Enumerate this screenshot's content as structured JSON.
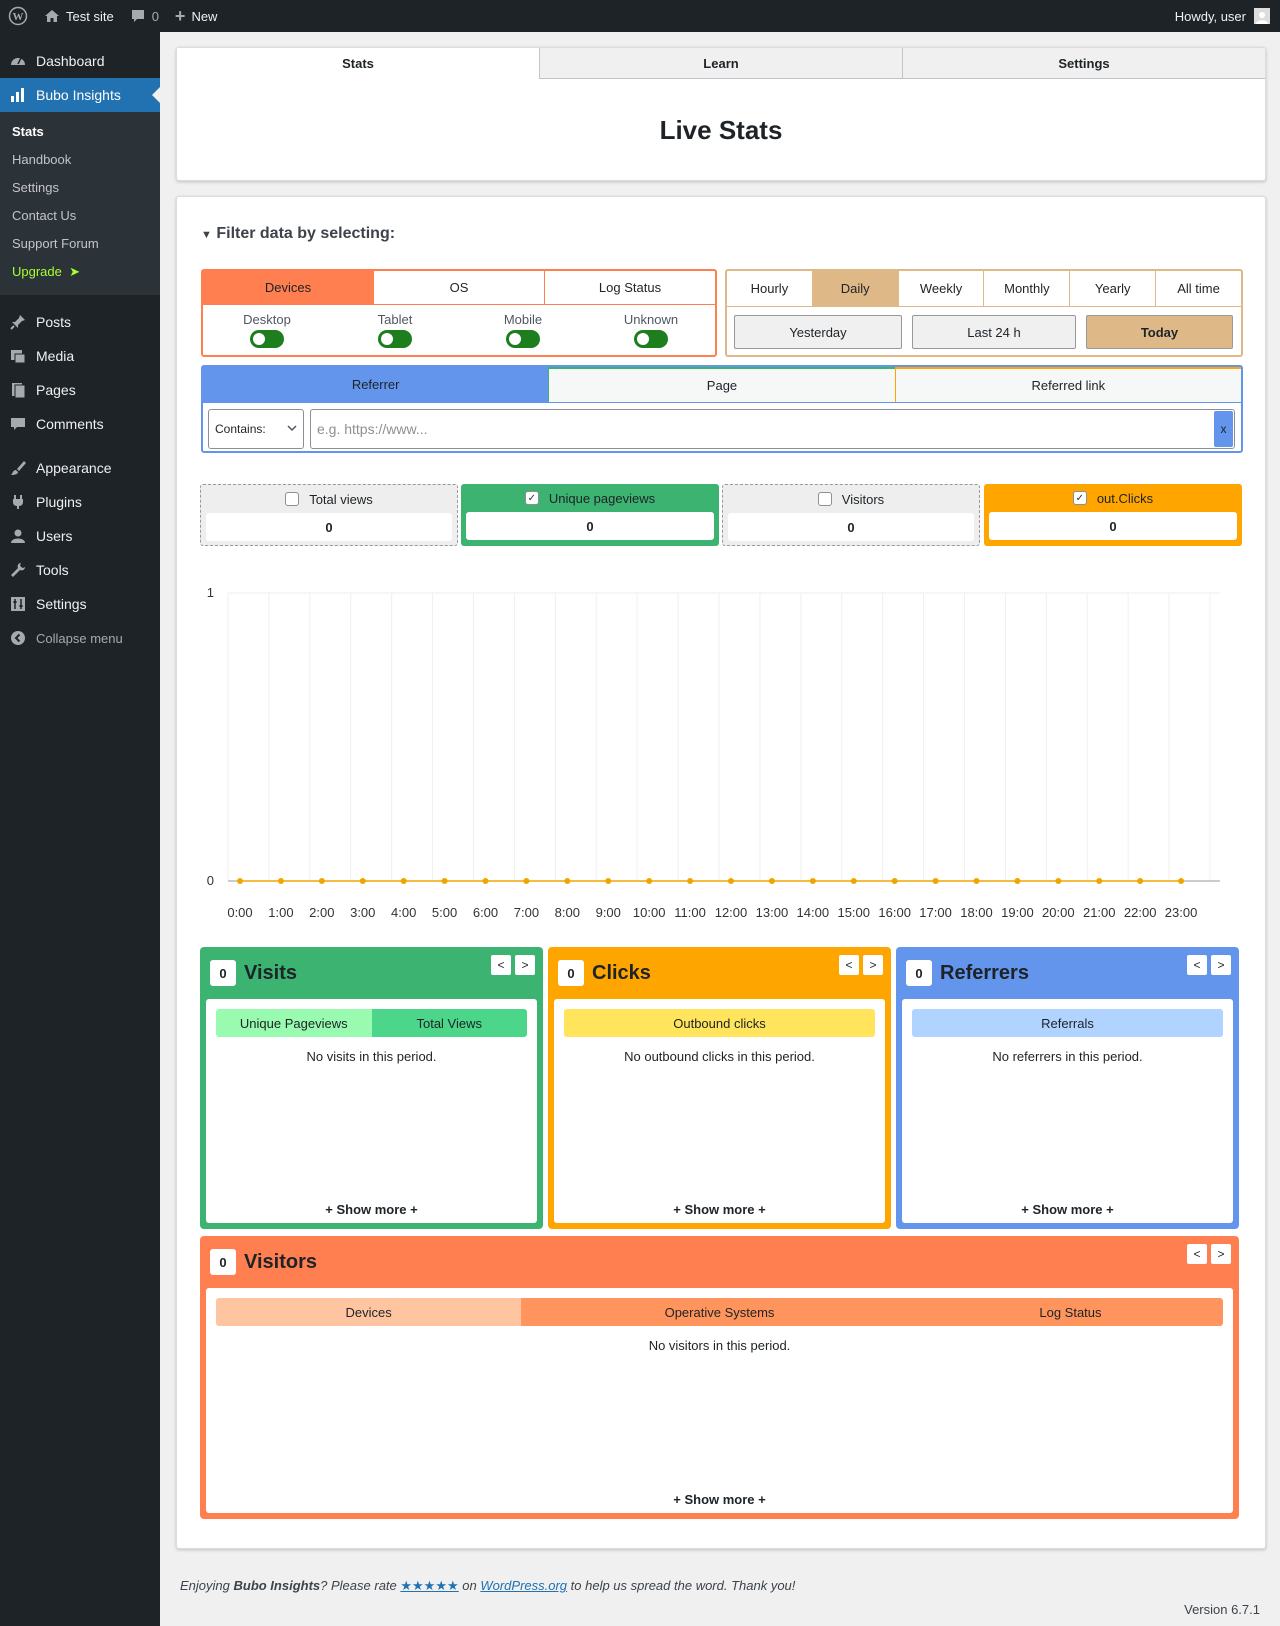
{
  "adminbar": {
    "site": "Test site",
    "comments": "0",
    "new": "New",
    "howdy": "Howdy, user"
  },
  "menu": {
    "dashboard": "Dashboard",
    "bubo": "Bubo Insights",
    "sub": {
      "stats": "Stats",
      "handbook": "Handbook",
      "settings": "Settings",
      "contact": "Contact Us",
      "support": "Support Forum",
      "upgrade": "Upgrade"
    },
    "posts": "Posts",
    "media": "Media",
    "pages": "Pages",
    "comments": "Comments",
    "appearance": "Appearance",
    "plugins": "Plugins",
    "users": "Users",
    "tools": "Tools",
    "settings": "Settings",
    "collapse": "Collapse menu"
  },
  "tabs": {
    "stats": "Stats",
    "learn": "Learn",
    "settings": "Settings"
  },
  "title": "Live Stats",
  "filter": {
    "heading": "Filter data by selecting:",
    "groups": {
      "devices": "Devices",
      "os": "OS",
      "log": "Log Status"
    },
    "devices": {
      "desktop": "Desktop",
      "tablet": "Tablet",
      "mobile": "Mobile",
      "unknown": "Unknown"
    },
    "periods": {
      "hourly": "Hourly",
      "daily": "Daily",
      "weekly": "Weekly",
      "monthly": "Monthly",
      "yearly": "Yearly",
      "all": "All time"
    },
    "ranges": {
      "yesterday": "Yesterday",
      "last24": "Last 24 h",
      "today": "Today"
    },
    "search_tabs": {
      "referrer": "Referrer",
      "page": "Page",
      "referred": "Referred link"
    },
    "match": "Contains:",
    "placeholder": "e.g. https://www...",
    "clear": "x"
  },
  "metrics": {
    "total": {
      "label": "Total views",
      "value": "0",
      "checked": false
    },
    "unique": {
      "label": "Unique pageviews",
      "value": "0",
      "checked": true
    },
    "visitors": {
      "label": "Visitors",
      "value": "0",
      "checked": false
    },
    "clicks": {
      "label": "out.Clicks",
      "value": "0",
      "checked": true
    }
  },
  "chart_data": {
    "type": "line",
    "x": [
      "0:00",
      "1:00",
      "2:00",
      "3:00",
      "4:00",
      "5:00",
      "6:00",
      "7:00",
      "8:00",
      "9:00",
      "10:00",
      "11:00",
      "12:00",
      "13:00",
      "14:00",
      "15:00",
      "16:00",
      "17:00",
      "18:00",
      "19:00",
      "20:00",
      "21:00",
      "22:00",
      "23:00"
    ],
    "series": [
      {
        "values": [
          0,
          0,
          0,
          0,
          0,
          0,
          0,
          0,
          0,
          0,
          0,
          0,
          0,
          0,
          0,
          0,
          0,
          0,
          0,
          0,
          0,
          0,
          0,
          0
        ],
        "color": "#f0a500"
      }
    ],
    "yticks": [
      "1",
      "0"
    ],
    "ylim": [
      0,
      1
    ],
    "grid": true
  },
  "cards": {
    "visits": {
      "count": "0",
      "title": "Visits",
      "tab1": "Unique Pageviews",
      "tab2": "Total Views",
      "empty": "No visits in this period.",
      "more": "+ Show more +"
    },
    "clicks": {
      "count": "0",
      "title": "Clicks",
      "tab1": "Outbound clicks",
      "empty": "No outbound clicks in this period.",
      "more": "+ Show more +"
    },
    "referrers": {
      "count": "0",
      "title": "Referrers",
      "tab1": "Referrals",
      "empty": "No referrers in this period.",
      "more": "+ Show more +"
    },
    "visitors": {
      "count": "0",
      "title": "Visitors",
      "tab1": "Devices",
      "tab2": "Operative Systems",
      "tab3": "Log Status",
      "empty": "No visitors in this period.",
      "more": "+ Show more +"
    },
    "prev": "<",
    "next": ">"
  },
  "footer": {
    "pre": "Enjoying ",
    "plugin": "Bubo Insights",
    "mid": "? Please rate ",
    "stars": "★★★★★",
    "on": " on ",
    "wp": "WordPress.org",
    "post": " to help us spread the word. Thank you!",
    "version": "Version 6.7.1"
  },
  "colors": {
    "green": "#3cb371",
    "orange": "#ffa500",
    "blue": "#6495ed",
    "coral": "#ff7f50",
    "tan": "#deb887"
  }
}
